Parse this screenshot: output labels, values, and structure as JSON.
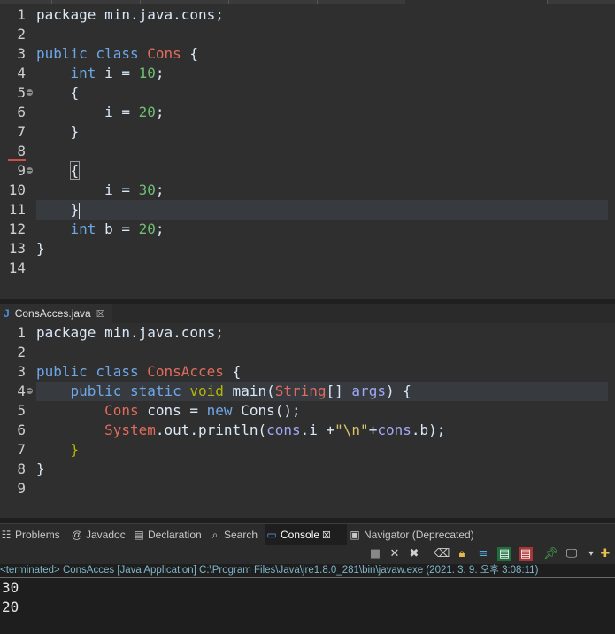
{
  "editor_top": {
    "lines": [
      {
        "n": "1",
        "tokens": [
          {
            "t": "package min.java.cons;",
            "c": ""
          }
        ]
      },
      {
        "n": "2",
        "tokens": []
      },
      {
        "n": "3",
        "tokens": [
          {
            "t": "public class ",
            "c": "k"
          },
          {
            "t": "Cons",
            "c": "cls"
          },
          {
            "t": " {",
            "c": ""
          }
        ]
      },
      {
        "n": "4",
        "tokens": [
          {
            "t": "    ",
            "c": ""
          },
          {
            "t": "int",
            "c": "k"
          },
          {
            "t": " i = ",
            "c": ""
          },
          {
            "t": "10",
            "c": "num"
          },
          {
            "t": ";",
            "c": ""
          }
        ]
      },
      {
        "n": "5",
        "tokens": [
          {
            "t": "    {",
            "c": ""
          }
        ]
      },
      {
        "n": "6",
        "tokens": [
          {
            "t": "        i = ",
            "c": ""
          },
          {
            "t": "20",
            "c": "num"
          },
          {
            "t": ";",
            "c": ""
          }
        ]
      },
      {
        "n": "7",
        "tokens": [
          {
            "t": "    }",
            "c": ""
          }
        ]
      },
      {
        "n": "8",
        "tokens": []
      },
      {
        "n": "9",
        "tokens": [
          {
            "t": "    ",
            "c": ""
          },
          {
            "t": "{",
            "c": "bracebox"
          }
        ]
      },
      {
        "n": "10",
        "tokens": [
          {
            "t": "        i = ",
            "c": ""
          },
          {
            "t": "30",
            "c": "num"
          },
          {
            "t": ";",
            "c": ""
          }
        ]
      },
      {
        "n": "11",
        "tokens": [
          {
            "t": "    }",
            "c": ""
          },
          {
            "t": "",
            "c": "caret"
          }
        ]
      },
      {
        "n": "12",
        "tokens": [
          {
            "t": "    ",
            "c": ""
          },
          {
            "t": "int",
            "c": "k"
          },
          {
            "t": " b = ",
            "c": ""
          },
          {
            "t": "20",
            "c": "num"
          },
          {
            "t": ";",
            "c": ""
          }
        ]
      },
      {
        "n": "13",
        "tokens": [
          {
            "t": "}",
            "c": ""
          }
        ]
      },
      {
        "n": "14",
        "tokens": []
      }
    ]
  },
  "file_tab": {
    "label": "ConsAcces.java",
    "icon": "J",
    "close": "☒"
  },
  "editor_bottom": {
    "lines": [
      {
        "n": "1",
        "tokens": [
          {
            "t": "package min.java.cons;",
            "c": ""
          }
        ]
      },
      {
        "n": "2",
        "tokens": []
      },
      {
        "n": "3",
        "tokens": [
          {
            "t": "public class ",
            "c": "k"
          },
          {
            "t": "ConsAcces",
            "c": "cls"
          },
          {
            "t": " {",
            "c": ""
          }
        ]
      },
      {
        "n": "4",
        "tokens": [
          {
            "t": "    ",
            "c": ""
          },
          {
            "t": "public static ",
            "c": "k"
          },
          {
            "t": "void",
            "c": "ann"
          },
          {
            "t": " main(",
            "c": ""
          },
          {
            "t": "String",
            "c": "cls"
          },
          {
            "t": "[] ",
            "c": ""
          },
          {
            "t": "args",
            "c": "var"
          },
          {
            "t": ") {",
            "c": ""
          }
        ]
      },
      {
        "n": "5",
        "tokens": [
          {
            "t": "        ",
            "c": ""
          },
          {
            "t": "Cons",
            "c": "cls"
          },
          {
            "t": " cons = ",
            "c": ""
          },
          {
            "t": "new",
            "c": "k"
          },
          {
            "t": " Cons();",
            "c": ""
          }
        ]
      },
      {
        "n": "6",
        "tokens": [
          {
            "t": "        ",
            "c": ""
          },
          {
            "t": "System",
            "c": "cls"
          },
          {
            "t": ".out.println(",
            "c": ""
          },
          {
            "t": "cons",
            "c": "var"
          },
          {
            "t": ".i +",
            "c": ""
          },
          {
            "t": "\"\\n\"",
            "c": "str"
          },
          {
            "t": "+",
            "c": ""
          },
          {
            "t": "cons",
            "c": "var"
          },
          {
            "t": ".b);",
            "c": ""
          }
        ]
      },
      {
        "n": "7",
        "tokens": [
          {
            "t": "    ",
            "c": ""
          },
          {
            "t": "}",
            "c": "ann"
          }
        ]
      },
      {
        "n": "8",
        "tokens": [
          {
            "t": "}",
            "c": ""
          }
        ]
      },
      {
        "n": "9",
        "tokens": []
      }
    ]
  },
  "views": [
    {
      "label": "Problems",
      "icon": "☷",
      "active": false
    },
    {
      "label": "Javadoc",
      "icon": "@",
      "active": false
    },
    {
      "label": "Declaration",
      "icon": "▤",
      "active": false
    },
    {
      "label": "Search",
      "icon": "⌕",
      "active": false
    },
    {
      "label": "Console",
      "icon": "▭",
      "active": true,
      "close": "☒"
    },
    {
      "label": "Navigator (Deprecated)",
      "icon": "▣",
      "active": false
    }
  ],
  "status_line": "<terminated> ConsAcces [Java Application] C:\\Program Files\\Java\\jre1.8.0_281\\bin\\javaw.exe  (2021. 3. 9. 오후 3:08:11)",
  "console_output": [
    "30",
    "20"
  ]
}
